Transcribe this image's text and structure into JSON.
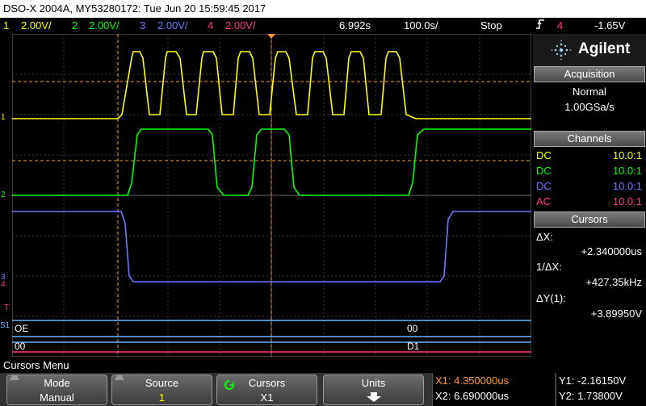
{
  "title": "DSO-X 2004A, MY53280172: Tue Jun 20 15:59:45 2017",
  "status": {
    "ch1": {
      "num": "1",
      "scale": "2.00V/",
      "color": "#ffff00"
    },
    "ch2": {
      "num": "2",
      "scale": "2.00V/",
      "color": "#00ff00"
    },
    "ch3": {
      "num": "3",
      "scale": "2.00V/",
      "color": "#6a7bff"
    },
    "ch4": {
      "num": "4",
      "scale": "2.00V/",
      "color": "#ff3c7a"
    },
    "time_pos": "6.992s",
    "time_scale": "100.0s/",
    "run_state": "Stop",
    "trig_icon": "trigger-edge-icon",
    "trig_ch": "4",
    "trig_level": "-1.65V"
  },
  "graticule": {
    "ch_markers": [
      "1",
      "2",
      "3",
      "4",
      "T",
      "S1"
    ],
    "bus_top": [
      "OE",
      "00"
    ],
    "bus_bottom": [
      "00",
      "D1"
    ]
  },
  "panel": {
    "brand": "Agilent",
    "acquisition_head": "Acquisition",
    "acq_mode": "Normal",
    "acq_rate": "1.00GSa/s",
    "channels_head": "Channels",
    "channels": [
      {
        "coupling": "DC",
        "probe": "10.0:1",
        "color": "#ffff00"
      },
      {
        "coupling": "DC",
        "probe": "10.0:1",
        "color": "#00ff00"
      },
      {
        "coupling": "DC",
        "probe": "10.0:1",
        "color": "#6a7bff"
      },
      {
        "coupling": "AC",
        "probe": "10.0:1",
        "color": "#ff3c7a"
      }
    ],
    "cursors_head": "Cursors",
    "dx_label": "ΔX:",
    "dx_value": "+2.340000us",
    "inv_dx_label": "1/ΔX:",
    "inv_dx_value": "+427.35kHz",
    "dy_label": "ΔY(1):",
    "dy_value": "+3.89950V"
  },
  "menu": {
    "title": "Cursors Menu",
    "keys": [
      {
        "label": "Mode",
        "value": "Manual"
      },
      {
        "label": "Source",
        "value": "1"
      },
      {
        "label": "Cursors",
        "value": "X1"
      },
      {
        "label": "Units",
        "value": ""
      }
    ],
    "x1": "X1: 4.350000us",
    "x2": "X2: 6.690000us",
    "y1": "Y1: -2.16150V",
    "y2": "Y2: 1.73800V",
    "x_color": "#ff9a2a"
  }
}
